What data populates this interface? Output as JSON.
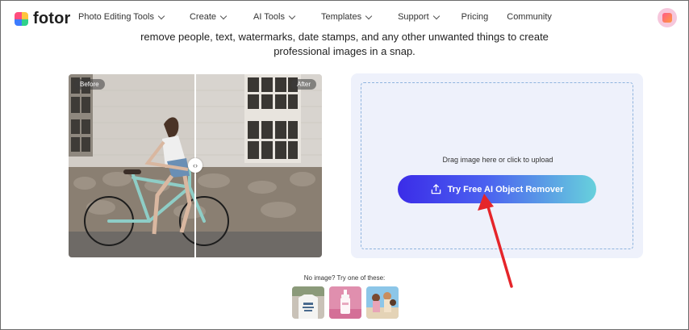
{
  "brand": {
    "name": "fotor",
    "logo_icon": "fotor-logo-icon"
  },
  "nav": {
    "items": [
      {
        "label": "Photo Editing Tools",
        "dropdown": true
      },
      {
        "label": "Create",
        "dropdown": true
      },
      {
        "label": "AI Tools",
        "dropdown": true
      },
      {
        "label": "Templates",
        "dropdown": true
      },
      {
        "label": "Support",
        "dropdown": true
      },
      {
        "label": "Pricing",
        "dropdown": false
      },
      {
        "label": "Community",
        "dropdown": false
      }
    ]
  },
  "hero": {
    "subtitle_line1": "remove people, text, watermarks, date stamps, and any other unwanted things to create",
    "subtitle_line2": "professional images in a snap."
  },
  "compare": {
    "before_label": "Before",
    "after_label": "After",
    "handle_icon": "left-right-arrows-icon"
  },
  "upload": {
    "drag_text": "Drag image here or click to upload",
    "button_label": "Try Free AI Object Remover",
    "button_icon": "upload-icon"
  },
  "samples": {
    "label": "No image? Try one of these:",
    "thumbnails": [
      "sample-tshirt-thumb",
      "sample-cosmetic-bottle-thumb",
      "sample-beach-people-thumb"
    ]
  },
  "colors": {
    "button_gradient_start": "#3b2ce8",
    "button_gradient_end": "#67d1dc",
    "panel_bg": "#eef1fb",
    "arrow": "#e5252a"
  }
}
